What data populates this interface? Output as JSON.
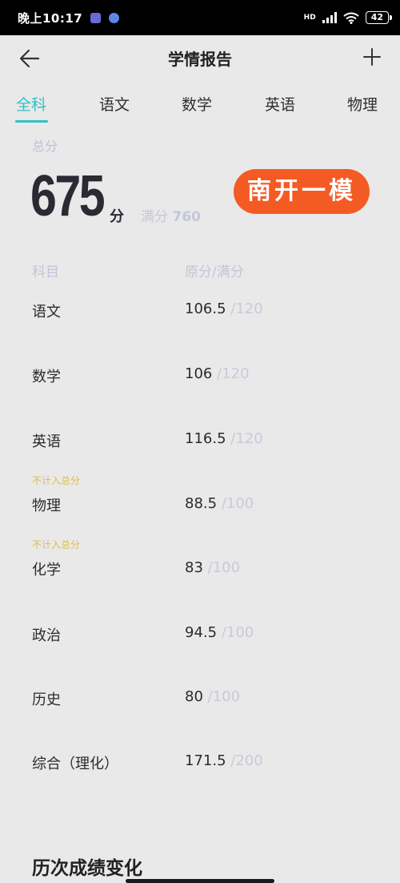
{
  "status": {
    "time": "晚上10:17",
    "network": "HD",
    "battery": "42"
  },
  "header": {
    "title": "学情报告"
  },
  "tabs": [
    {
      "label": "全科",
      "active": true
    },
    {
      "label": "语文",
      "active": false
    },
    {
      "label": "数学",
      "active": false
    },
    {
      "label": "英语",
      "active": false
    },
    {
      "label": "物理",
      "active": false
    }
  ],
  "summary": {
    "total_label": "总分",
    "score": "675",
    "score_unit": "分",
    "full_label": "满分",
    "full_value": "760",
    "exam_badge": "南开一模"
  },
  "table": {
    "col_subject": "科目",
    "col_score": "原分/满分",
    "rows": [
      {
        "subject": "语文",
        "score": "106.5",
        "max": "/120",
        "note": ""
      },
      {
        "subject": "数学",
        "score": "106",
        "max": "/120",
        "note": ""
      },
      {
        "subject": "英语",
        "score": "116.5",
        "max": "/120",
        "note": ""
      },
      {
        "subject": "物理",
        "score": "88.5",
        "max": "/100",
        "note": "不计入总分"
      },
      {
        "subject": "化学",
        "score": "83",
        "max": "/100",
        "note": "不计入总分"
      },
      {
        "subject": "政治",
        "score": "94.5",
        "max": "/100",
        "note": ""
      },
      {
        "subject": "历史",
        "score": "80",
        "max": "/100",
        "note": ""
      },
      {
        "subject": "综合（理化）",
        "score": "171.5",
        "max": "/200",
        "note": ""
      }
    ]
  },
  "trend_section": {
    "title": "历次成绩变化"
  },
  "colors": {
    "accent": "#2fc1c8",
    "badge": "#f45b24",
    "note": "#e1bb48",
    "muted": "#c1c5d6"
  }
}
